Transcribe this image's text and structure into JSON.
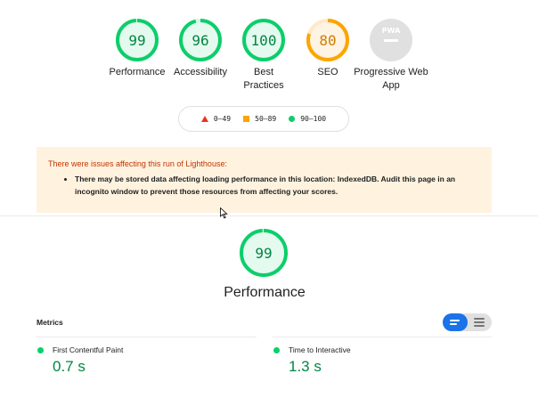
{
  "scores": [
    {
      "value": "99",
      "label": "Performance",
      "fraction": 0.99,
      "color": "#0cce6b",
      "text_color": "#018642",
      "bg": "#e5faef"
    },
    {
      "value": "96",
      "label": "Accessibility",
      "fraction": 0.96,
      "color": "#0cce6b",
      "text_color": "#018642",
      "bg": "#e5faef"
    },
    {
      "value": "100",
      "label": "Best Practices",
      "fraction": 1.0,
      "color": "#0cce6b",
      "text_color": "#018642",
      "bg": "#e5faef"
    },
    {
      "value": "80",
      "label": "SEO",
      "fraction": 0.8,
      "color": "#fca500",
      "text_color": "#d07c00",
      "bg": "#fff4e3"
    },
    {
      "value": "",
      "label": "Progressive Web App",
      "icon": "pwa-icon"
    }
  ],
  "legend": [
    {
      "range": "0–49",
      "shape": "triangle",
      "color": "#eb3323"
    },
    {
      "range": "50–89",
      "shape": "square",
      "color": "#fca500"
    },
    {
      "range": "90–100",
      "shape": "circle",
      "color": "#0cce6b"
    }
  ],
  "warning": {
    "title": "There were issues affecting this run of Lighthouse:",
    "items": [
      "There may be stored data affecting loading performance in this location: IndexedDB. Audit this page in an incognito window to prevent those resources from affecting your scores."
    ]
  },
  "category": {
    "score": "99",
    "fraction": 0.99,
    "title": "Performance"
  },
  "metrics": {
    "heading": "Metrics",
    "items": [
      {
        "label": "First Contentful Paint",
        "value": "0.7 s",
        "status": "pass"
      },
      {
        "label": "Time to Interactive",
        "value": "1.3 s",
        "status": "pass"
      }
    ]
  },
  "view_toggle": {
    "active": "list-view-icon",
    "inactive": "text-view-icon"
  },
  "pwa_badge_text": "PWA"
}
